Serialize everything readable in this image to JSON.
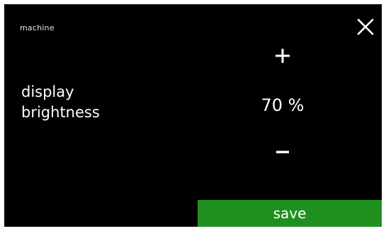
{
  "header": {
    "breadcrumb": "machine",
    "close_icon": "close-icon"
  },
  "setting": {
    "label_line1": "display",
    "label_line2": "brightness",
    "value": "70 %",
    "value_percent": 70
  },
  "controls": {
    "increase_icon": "plus-icon",
    "decrease_icon": "minus-icon"
  },
  "footer": {
    "save_label": "save"
  },
  "colors": {
    "background": "#000000",
    "text": "#ffffff",
    "save_button": "#1f8f1f",
    "frame": "#ffffff"
  }
}
